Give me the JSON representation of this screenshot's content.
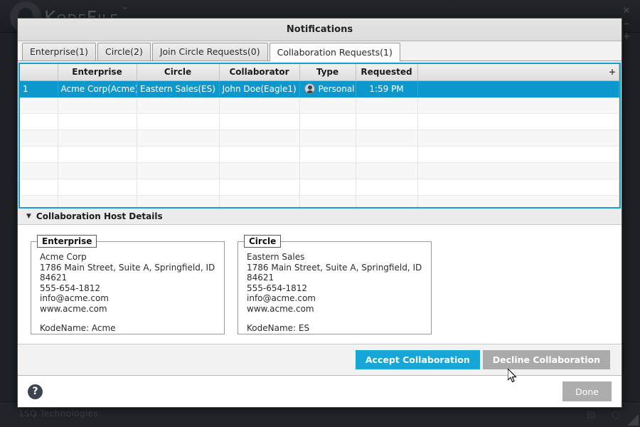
{
  "background": {
    "logo_text": "KodeFile",
    "logo_tm": "™",
    "footer_text": "1SQ Technologies",
    "window_controls": {
      "close": "✕",
      "minimize": "–",
      "plus": "+"
    },
    "footer_icons": {
      "document": "▤",
      "circle": "○"
    }
  },
  "dialog": {
    "title": "Notifications",
    "tabs": [
      {
        "label": "Enterprise(1)",
        "active": false
      },
      {
        "label": "Circle(2)",
        "active": false
      },
      {
        "label": "Join Circle Requests(0)",
        "active": false
      },
      {
        "label": "Collaboration Requests(1)",
        "active": true
      }
    ],
    "table": {
      "columns": [
        "",
        "Enterprise",
        "Circle",
        "Collaborator",
        "Type",
        "Requested",
        ""
      ],
      "add_column_icon": "+",
      "rows": [
        {
          "num": "1",
          "enterprise": "Acme Corp(Acme)",
          "circle": "Eastern Sales(ES)",
          "collaborator": "John Doe(Eagle1)",
          "type": "Personal",
          "type_icon": "avatar-icon",
          "requested": "1:59 PM",
          "selected": true
        }
      ],
      "empty_row_count": 7
    },
    "details": {
      "header_label": "Collaboration Host Details",
      "disclosure_icon": "▼",
      "expanded": true,
      "panels": [
        {
          "legend": "Enterprise",
          "lines": [
            "Acme Corp",
            "1786 Main Street, Suite A, Springfield, ID 84621",
            "555-654-1812",
            "info@acme.com",
            "www.acme.com",
            "",
            "KodeName: Acme"
          ]
        },
        {
          "legend": "Circle",
          "lines": [
            "Eastern Sales",
            "1786 Main Street, Suite A, Springfield, ID 84621",
            "555-654-1812",
            "info@acme.com",
            "www.acme.com",
            "",
            "KodeName: ES"
          ]
        }
      ]
    },
    "actions": {
      "accept_label": "Accept Collaboration",
      "decline_label": "Decline Collaboration",
      "accept_color": "#16a7d8",
      "decline_color": "#aaaaaa"
    },
    "footer": {
      "help_icon": "?",
      "done_label": "Done"
    }
  },
  "theme": {
    "selection_blue": "#0c98cc",
    "table_border_blue": "#16a0cf",
    "accent": "#16a7d8"
  }
}
